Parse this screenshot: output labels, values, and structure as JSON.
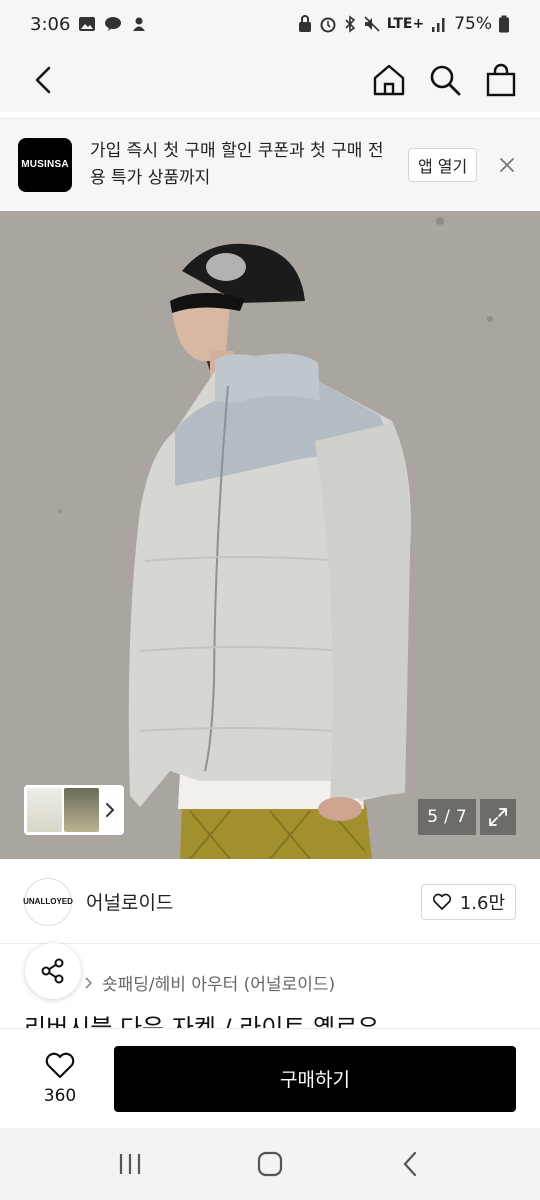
{
  "status_bar": {
    "time": "3:06",
    "network": "LTE+",
    "battery": "75%"
  },
  "banner": {
    "logo_text": "MUSINSA",
    "message": "가입 즉시 첫 구매 할인 쿠폰과 첫 구매 전용 특가 상품까지",
    "open_app_label": "앱 열기"
  },
  "gallery": {
    "current": "5",
    "separator": "/",
    "total": "7"
  },
  "brand": {
    "logo_text": "UNALLOYED",
    "name": "어널로이드",
    "likes": "1.6만"
  },
  "product": {
    "category": "숏패딩/헤비 아우터 (어널로이드)",
    "title": "리버시블 다운 자켓 / 라이트 옐로우"
  },
  "bottom": {
    "wish_count": "360",
    "buy_label": "구매하기"
  },
  "colors": {
    "primary_button": "#000000",
    "background": "#ffffff",
    "banner_bg": "#f6f6f6"
  }
}
